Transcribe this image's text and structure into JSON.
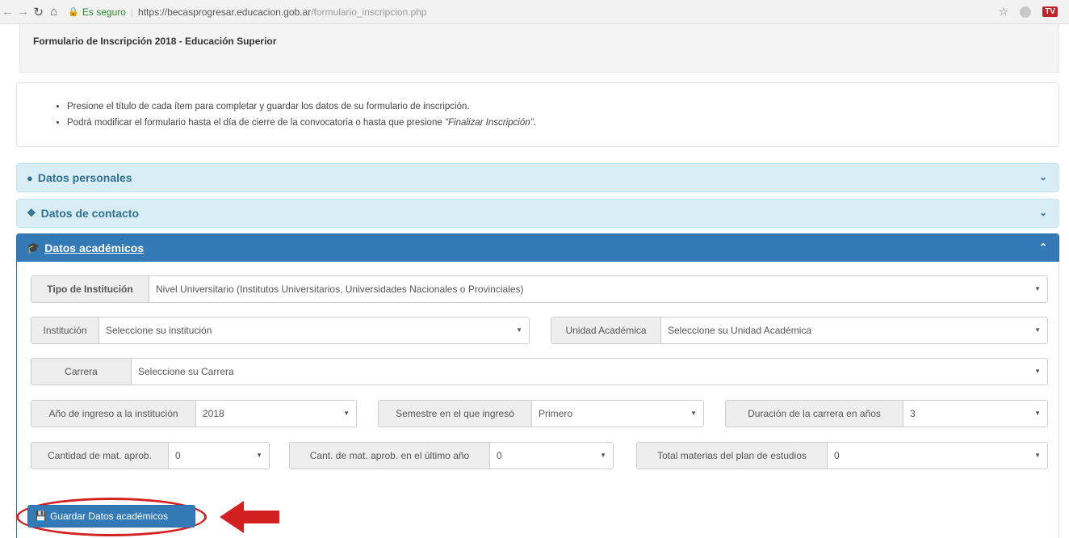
{
  "browser": {
    "secure_label": "Es seguro",
    "url_domain": "https://becasprogresar.educacion.gob.ar",
    "url_path": "/formulario_inscripcion.php",
    "star_icon": "star-icon",
    "badge": "TV"
  },
  "page": {
    "title": "Formulario de Inscripción 2018 - Educación Superior"
  },
  "info": {
    "line1": "Presione el título de cada ítem para completar y guardar los datos de su formulario de inscripción.",
    "line2_prefix": "Podrá modificar el formulario hasta el día de cierre de la convocatoria o hasta que presione ",
    "line2_em": "\"Finalizar Inscripción\"",
    "line2_suffix": "."
  },
  "panels": {
    "personales": {
      "label": "Datos personales",
      "icon": "user-icon"
    },
    "contacto": {
      "label": "Datos de contacto",
      "icon": "info-icon"
    },
    "academicos": {
      "label": "Datos académicos",
      "icon": "graduation-cap-icon"
    }
  },
  "form": {
    "tipo": {
      "label": "Tipo de Institución",
      "value": "Nivel Universitario (Institutos Universitarios, Universidades Nacionales o Provinciales)"
    },
    "institucion": {
      "label": "Institución",
      "value": "Seleccione su institución"
    },
    "unidad": {
      "label": "Unidad Académica",
      "value": "Seleccione su Unidad Académica"
    },
    "carrera": {
      "label": "Carrera",
      "value": "Seleccione su Carrera"
    },
    "anio": {
      "label": "Año de ingreso a la institución",
      "value": "2018"
    },
    "semestre": {
      "label": "Semestre en el que ingresó",
      "value": "Primero"
    },
    "duracion": {
      "label": "Duración de la carrera en años",
      "value": "3"
    },
    "cantidad": {
      "label": "Cantidad de mat. aprob.",
      "value": "0"
    },
    "cant_ultimo": {
      "label": "Cant. de mat. aprob. en el último año",
      "value": "0"
    },
    "total": {
      "label": "Total materias del plan de estudios",
      "value": "0"
    }
  },
  "save_button": {
    "label": "Guardar Datos académicos",
    "icon": "save-icon"
  },
  "colors": {
    "primary": "#337ab7",
    "panel_light": "#d9edf7",
    "annotation": "#d42020"
  }
}
